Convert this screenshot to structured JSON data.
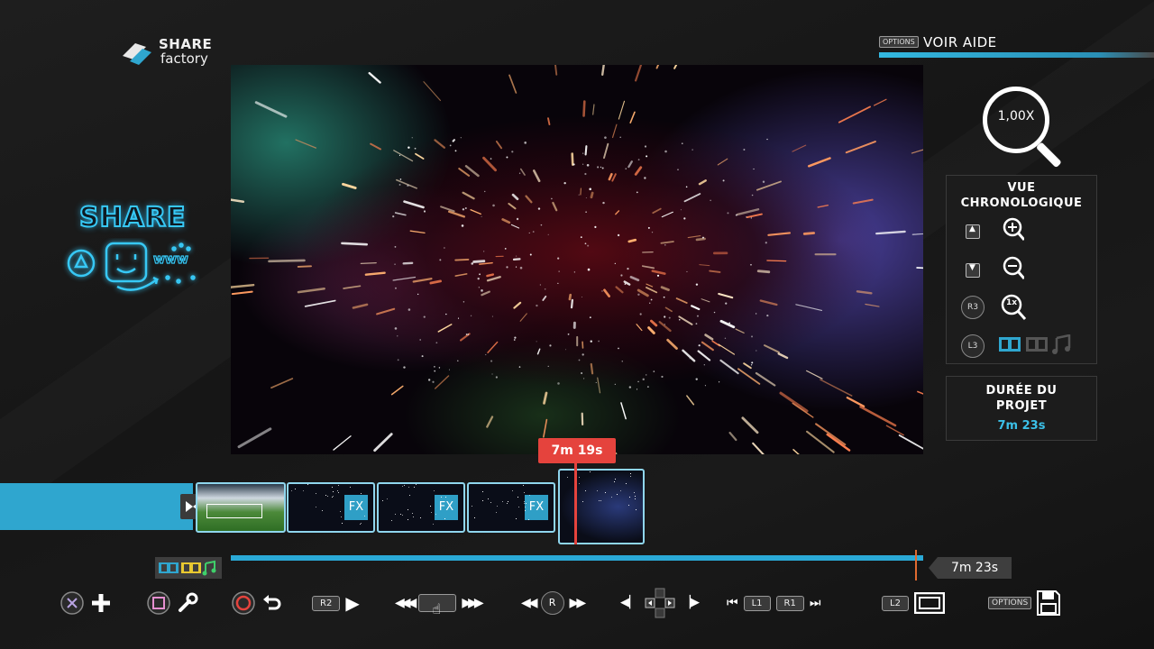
{
  "app": {
    "logo_line1": "SHARE",
    "logo_line2": "factory"
  },
  "help": {
    "button": "OPTIONS",
    "label": "VOIR AIDE"
  },
  "share_panel": {
    "label": "SHARE",
    "web_text": "www"
  },
  "zoom": {
    "value": "1,00X"
  },
  "timeline_view": {
    "title_line1": "VUE",
    "title_line2": "CHRONOLOGIQUE",
    "zoom_in_button": "▲",
    "zoom_out_button": "▼",
    "reset_button": "R3",
    "reset_zoom_label": "1x",
    "track_button": "L3"
  },
  "project_duration": {
    "title_line1": "DURÉE DU",
    "title_line2": "PROJET",
    "value": "7m 23s"
  },
  "timeline": {
    "playhead_time": "7m 19s",
    "end_time": "7m 23s",
    "playhead_fraction": 0.99,
    "clips": [
      {
        "type": "stadium",
        "label": ""
      },
      {
        "type": "fx",
        "label": "FX"
      },
      {
        "type": "fx",
        "label": "FX"
      },
      {
        "type": "fx",
        "label": "FX"
      },
      {
        "type": "space",
        "label": ""
      }
    ]
  },
  "controls": {
    "r2": "R2",
    "r_stick": "R",
    "l1": "L1",
    "r1": "R1",
    "l2": "L2",
    "options": "OPTIONS"
  },
  "colors": {
    "accent": "#2fa6cf",
    "playhead": "#e5433d",
    "neon": "#37c8f5"
  }
}
